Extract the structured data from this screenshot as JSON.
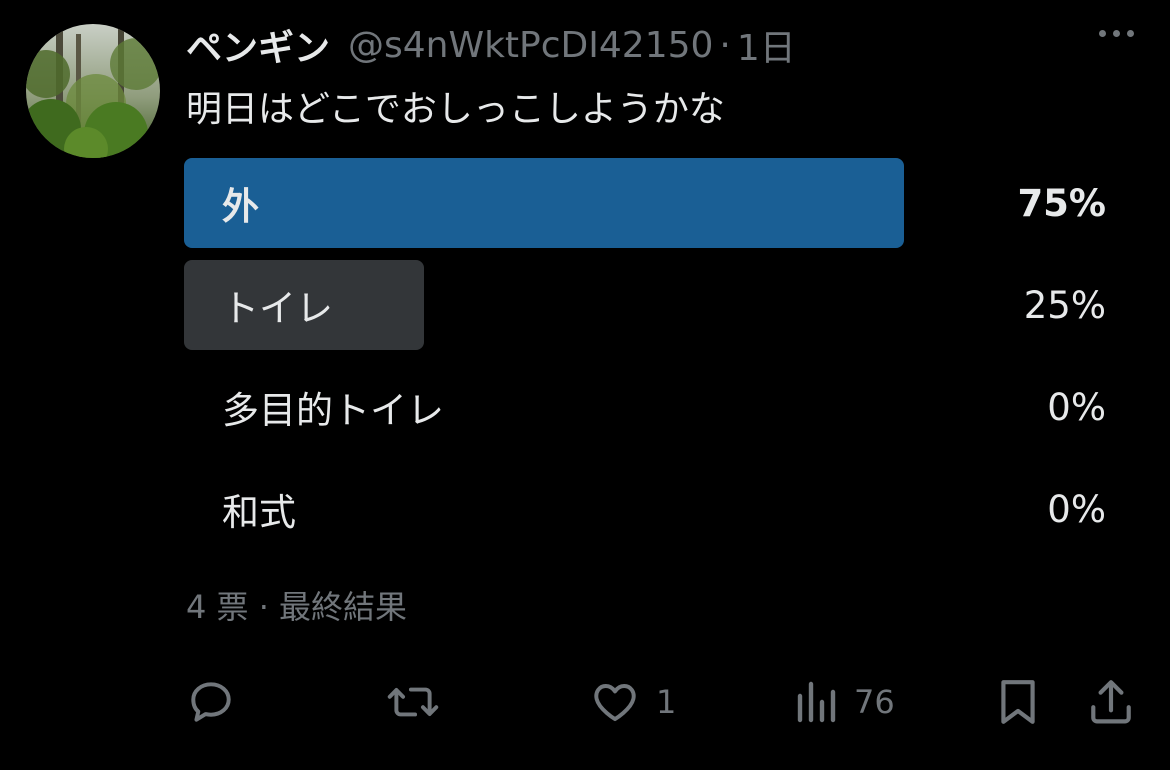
{
  "tweet": {
    "author": {
      "display_name": "ペンギン",
      "handle": "@s4nWktPcDI42150",
      "separator": "·",
      "time": "1日"
    },
    "text": "明日はどこでおしっこしようかな"
  },
  "poll": {
    "options": [
      {
        "label": "外",
        "percent_text": "75%",
        "percent": 75,
        "winner": true,
        "bar_color": "#1a5f95"
      },
      {
        "label": "トイレ",
        "percent_text": "25%",
        "percent": 25,
        "winner": false,
        "bar_color": "#333639"
      },
      {
        "label": "多目的トイレ",
        "percent_text": "0%",
        "percent": 0,
        "winner": false,
        "bar_color": "#333639"
      },
      {
        "label": "和式",
        "percent_text": "0%",
        "percent": 0,
        "winner": false,
        "bar_color": "#333639"
      }
    ],
    "meta": "4 票 · 最終結果"
  },
  "actions": {
    "reply_icon": "reply-icon",
    "retweet_icon": "retweet-icon",
    "like_icon": "heart-icon",
    "like_count": "1",
    "views_icon": "views-icon",
    "views_count": "76",
    "bookmark_icon": "bookmark-icon",
    "share_icon": "share-icon"
  },
  "colors": {
    "background": "#000000",
    "text_primary": "#e7e9ea",
    "text_secondary": "#71767b",
    "accent_bar": "#1a5f95",
    "neutral_bar": "#333639"
  }
}
